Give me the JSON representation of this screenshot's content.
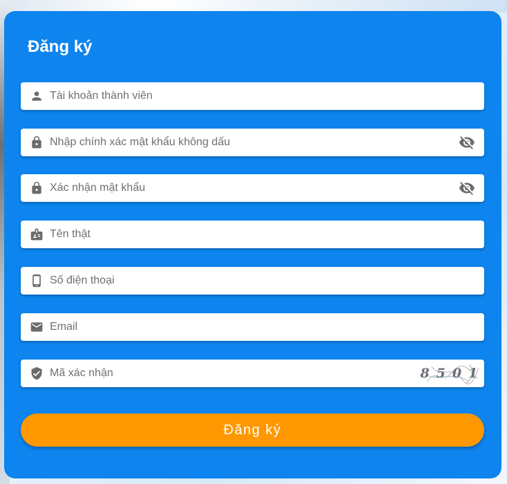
{
  "form": {
    "title": "Đăng ký",
    "fields": [
      {
        "name": "username",
        "icon": "person-icon",
        "value": "",
        "placeholder": "Tài khoản thành viên"
      },
      {
        "name": "password",
        "icon": "lock-icon",
        "value": "",
        "placeholder": "Nhập chính xác mật khẩu không dấu",
        "toggle_icon": "eye-off-icon"
      },
      {
        "name": "confirm_password",
        "icon": "lock-icon",
        "value": "",
        "placeholder": "Xác nhận mật khẩu",
        "toggle_icon": "eye-off-icon"
      },
      {
        "name": "real_name",
        "icon": "id-badge-icon",
        "value": "",
        "placeholder": "Tên thật"
      },
      {
        "name": "phone",
        "icon": "smartphone-icon",
        "value": "",
        "placeholder": "Số điện thoại"
      },
      {
        "name": "email",
        "icon": "mail-icon",
        "value": "",
        "placeholder": "Email"
      },
      {
        "name": "captcha",
        "icon": "shield-check-icon",
        "value": "",
        "placeholder": "Mã xác nhận"
      }
    ],
    "captcha_code": "8501",
    "submit_label": "Đăng ký"
  },
  "colors": {
    "card": "#0d84ee",
    "button": "#ff9800",
    "icon": "#6b6b6b"
  }
}
